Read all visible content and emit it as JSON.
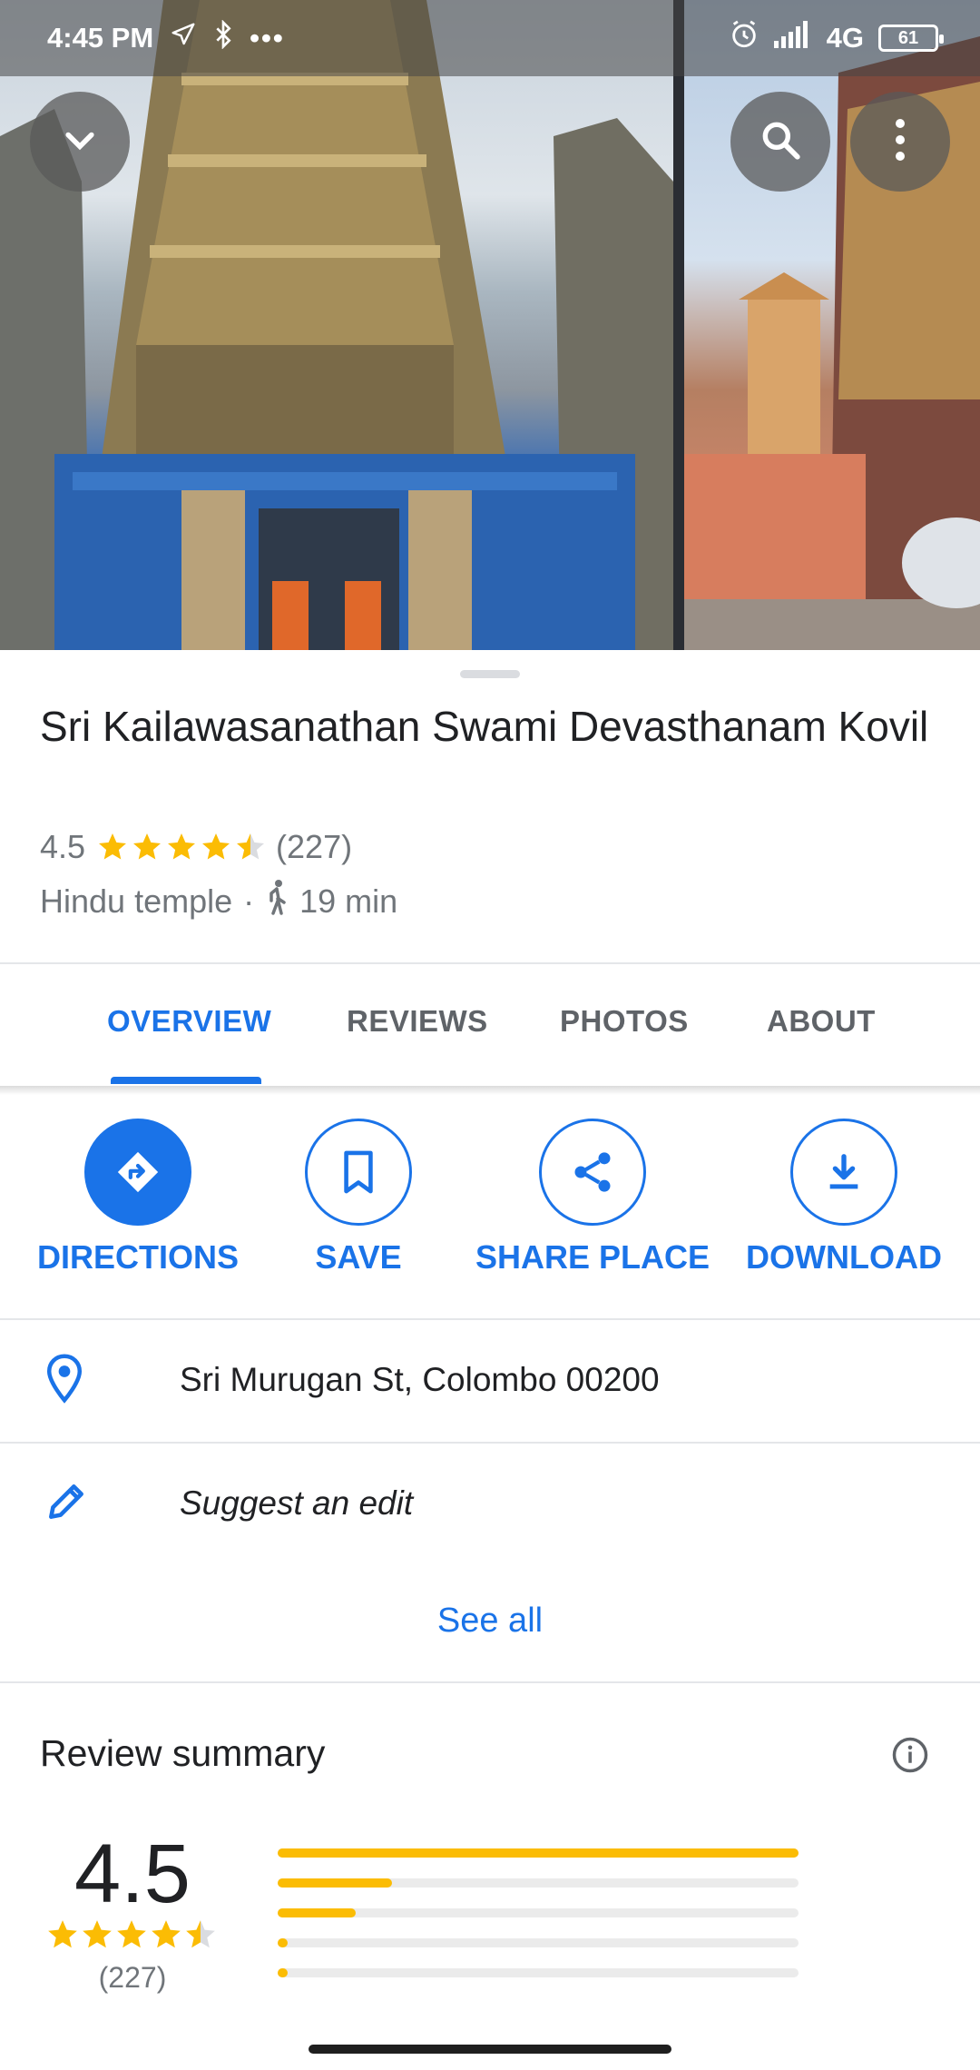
{
  "status_bar": {
    "time": "4:45 PM",
    "icons": [
      "location-arrow-icon",
      "bluetooth-icon",
      "more-dots-icon",
      "alarm-icon",
      "signal-icon"
    ],
    "network": "4G",
    "battery": "61"
  },
  "header_buttons": [
    "collapse-chevron-icon",
    "search-icon",
    "overflow-menu-icon"
  ],
  "place": {
    "name": "Sri Kailawasanathan Swami Devasthanam Kovil",
    "rating": "4.5",
    "stars": 4.5,
    "review_count": "(227)",
    "category": "Hindu temple",
    "separator": "·",
    "travel_time": "19 min"
  },
  "tabs": [
    {
      "label": "OVERVIEW",
      "active": true
    },
    {
      "label": "REVIEWS",
      "active": false
    },
    {
      "label": "PHOTOS",
      "active": false
    },
    {
      "label": "ABOUT",
      "active": false
    }
  ],
  "actions": [
    {
      "label": "DIRECTIONS",
      "icon": "directions-icon"
    },
    {
      "label": "SAVE",
      "icon": "bookmark-icon"
    },
    {
      "label": "SHARE PLACE",
      "icon": "share-icon"
    },
    {
      "label": "DOWNLOAD",
      "icon": "download-icon"
    }
  ],
  "info": {
    "address": "Sri Murugan St, Colombo 00200",
    "suggest_edit": "Suggest an edit",
    "see_all": "See all"
  },
  "review_summary": {
    "title": "Review summary",
    "rating": "4.5",
    "stars": 4.5,
    "count": "(227)",
    "distribution": [
      {
        "stars": 5,
        "fraction": 1.0
      },
      {
        "stars": 4,
        "fraction": 0.22
      },
      {
        "stars": 3,
        "fraction": 0.15
      },
      {
        "stars": 2,
        "fraction": 0.02
      },
      {
        "stars": 1,
        "fraction": 0.01
      }
    ]
  },
  "colors": {
    "accent": "#1a73e8",
    "star": "#fbbc04",
    "muted_text": "#70757a"
  }
}
